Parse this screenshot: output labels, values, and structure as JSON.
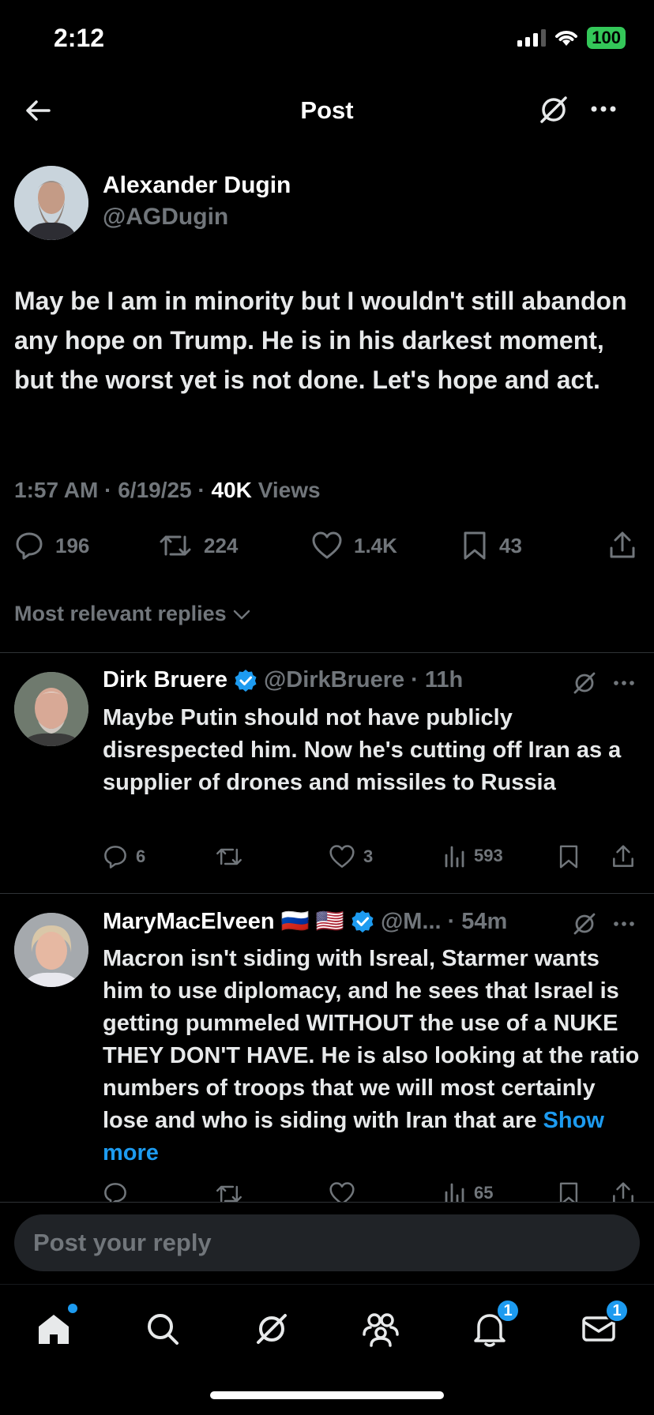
{
  "status_bar": {
    "time": "2:12",
    "battery": "100"
  },
  "header": {
    "title": "Post"
  },
  "post": {
    "author_name": "Alexander Dugin",
    "author_handle": "@AGDugin",
    "text": "May be I am in minority but I wouldn't still abandon any hope on Trump. He is in his darkest moment, but the worst yet is not done. Let's hope and act.",
    "time": "1:57 AM",
    "date": "6/19/25",
    "views_count": "40K",
    "views_label": "Views",
    "replies": "196",
    "reposts": "224",
    "likes": "1.4K",
    "bookmarks": "43"
  },
  "replies_sort": {
    "label": "Most relevant replies"
  },
  "replies": [
    {
      "name": "Dirk Bruere",
      "handle": "@DirkBruere",
      "time": "11h",
      "text": "Maybe Putin should not have publicly disrespected him. Now he's cutting off Iran as a supplier of drones and missiles to Russia",
      "reply_count": "6",
      "repost_count": "",
      "like_count": "3",
      "views": "593"
    },
    {
      "name": "MaryMacElveen 🇷🇺 🇺🇸",
      "handle": "@M...",
      "time": "54m",
      "text": "Macron isn't siding with Isreal, Starmer wants him to use diplomacy, and he sees that Israel is getting pummeled WITHOUT the use of a NUKE THEY DON'T HAVE. He is also looking at the ratio numbers of troops that we will most certainly lose and who is siding with Iran that are",
      "show_more": "Show more",
      "views": "65"
    }
  ],
  "composer": {
    "placeholder": "Post your reply"
  },
  "nav": {
    "notifications_badge": "1",
    "messages_badge": "1"
  },
  "colors": {
    "accent": "#1d9bf0",
    "muted": "#71767b",
    "background": "#000000"
  }
}
